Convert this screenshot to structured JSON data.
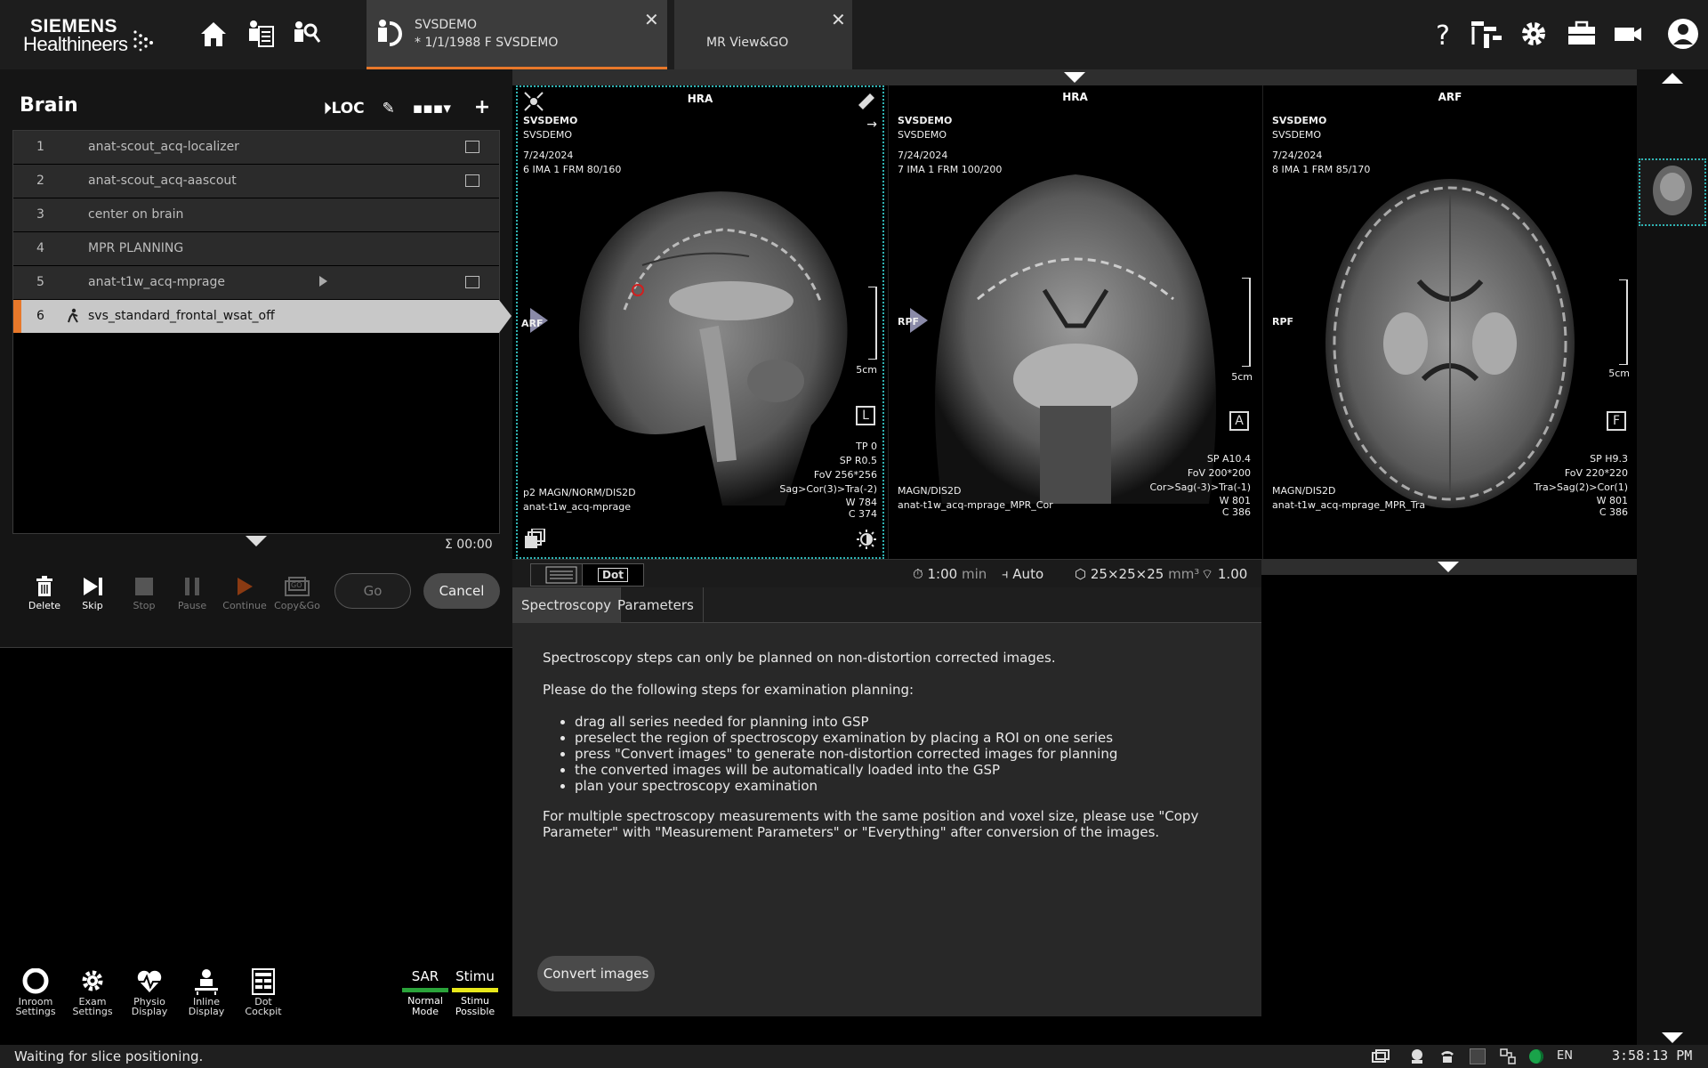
{
  "brand": {
    "line1": "SIEMENS",
    "line2": "Healthineers"
  },
  "tabs": {
    "patient": {
      "name": "SVSDEMO",
      "info": "* 1/1/1988 F SVSDEMO"
    },
    "app": {
      "label": "MR View&GO"
    }
  },
  "program": {
    "title": "Brain",
    "loc_label": "LOC",
    "steps": [
      {
        "num": "1",
        "name": "anat-scout_acq-localizer"
      },
      {
        "num": "2",
        "name": "anat-scout_acq-aascout"
      },
      {
        "num": "3",
        "name": "center on brain"
      },
      {
        "num": "4",
        "name": "MPR PLANNING"
      },
      {
        "num": "5",
        "name": "anat-t1w_acq-mprage"
      },
      {
        "num": "6",
        "name": "svs_standard_frontal_wsat_off"
      }
    ],
    "total_time": "Σ 00:00"
  },
  "controls": {
    "delete": "Delete",
    "skip": "Skip",
    "stop": "Stop",
    "pause": "Pause",
    "continue": "Continue",
    "copygo": "Copy&Go",
    "go": "Go",
    "cancel": "Cancel"
  },
  "bottom_tools": {
    "inroom": [
      "Inroom",
      "Settings"
    ],
    "exam": [
      "Exam",
      "Settings"
    ],
    "physio": [
      "Physio",
      "Display"
    ],
    "inline": [
      "Inline",
      "Display"
    ],
    "dot": [
      "Dot",
      "Cockpit"
    ],
    "sar": {
      "label": "SAR",
      "mode1": "Normal",
      "mode2": "Mode",
      "color": "#2aa33a"
    },
    "stimu": {
      "label": "Stimu",
      "mode1": "Stimu",
      "mode2": "Possible",
      "color": "#e8e81a"
    }
  },
  "viewports": [
    {
      "top": "HRA",
      "left_orient": "ARF",
      "name1": "SVSDEMO",
      "name2": "SVSDEMO",
      "date": "7/24/2024",
      "ima": "6 IMA 1 FRM 80/160",
      "scale": "5cm",
      "orient_box": "L",
      "br": [
        "TP 0",
        "SP R0.5",
        "FoV 256*256",
        "Sag>Cor(3)>Tra(-2)"
      ],
      "w": "784",
      "c": "374",
      "bl1": "p2 MAGN/NORM/DIS2D",
      "bl2": "anat-t1w_acq-mprage"
    },
    {
      "top": "HRA",
      "left_orient": "RPF",
      "name1": "SVSDEMO",
      "name2": "SVSDEMO",
      "date": "7/24/2024",
      "ima": "7 IMA 1 FRM 100/200",
      "scale": "5cm",
      "orient_box": "A",
      "br": [
        "SP A10.4",
        "FoV 200*200",
        "Cor>Sag(-3)>Tra(-1)"
      ],
      "w": "801",
      "c": "386",
      "bl1": "MAGN/DIS2D",
      "bl2": "anat-t1w_acq-mprage_MPR_Cor"
    },
    {
      "top": "ARF",
      "left_orient": "RPF",
      "name1": "SVSDEMO",
      "name2": "SVSDEMO",
      "date": "7/24/2024",
      "ima": "8 IMA 1 FRM 85/170",
      "scale": "5cm",
      "orient_box": "F",
      "br": [
        "SP H9.3",
        "FoV 220*220",
        "Tra>Sag(2)>Cor(1)"
      ],
      "w": "801",
      "c": "386",
      "bl1": "MAGN/DIS2D",
      "bl2": "anat-t1w_acq-mprage_MPR_Tra"
    }
  ],
  "seq_bar": {
    "dot_tab": "Dot",
    "time": "1:00",
    "time_unit": "min",
    "mode": "Auto",
    "voxel": "25×25×25",
    "voxel_unit": "mm³",
    "factor": "1.00"
  },
  "param_tabs": {
    "spectroscopy": "Spectroscopy",
    "parameters": "Parameters"
  },
  "content": {
    "p1": "Spectroscopy steps can only be planned on non-distortion corrected images.",
    "p2": "Please do the following steps for examination planning:",
    "bullets": [
      "drag all series needed for planning into GSP",
      "preselect the region of spectroscopy examination by placing a ROI on one series",
      "press \"Convert images\" to generate non-distortion corrected images for planning",
      "the converted images will be automatically loaded into the GSP",
      "plan your spectroscopy examination"
    ],
    "p3": "For multiple spectroscopy measurements with the same position and voxel size, please use \"Copy Parameter\" with \"Measurement Parameters\" or \"Everything\" after conversion of the images.",
    "convert": "Convert images"
  },
  "status": {
    "message": "Waiting for slice positioning.",
    "lang": "EN",
    "time": "3:58:13 PM"
  },
  "colors": {
    "accent": "#e8782a",
    "selection": "#2fb3b3"
  }
}
